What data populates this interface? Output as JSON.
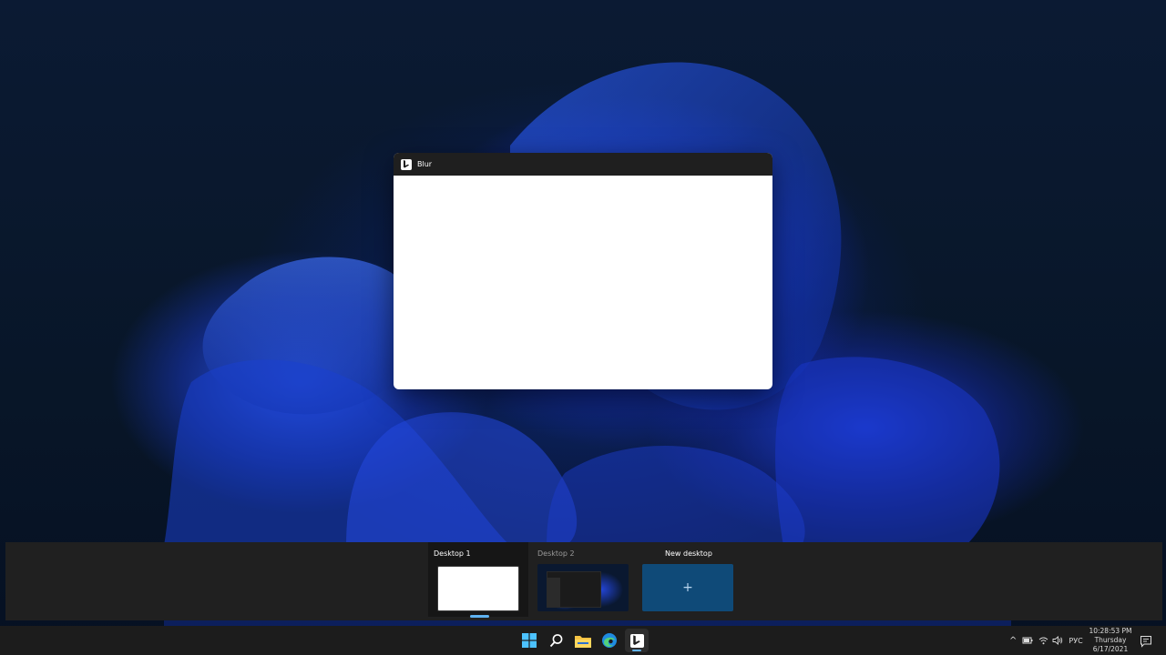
{
  "window": {
    "title": "Blur",
    "app_icon": "bing-b-icon"
  },
  "desktops": {
    "items": [
      {
        "label": "Desktop 1",
        "active": true
      },
      {
        "label": "Desktop 2",
        "active": false
      },
      {
        "label": "New desktop",
        "symbol": "+"
      }
    ]
  },
  "taskbar": {
    "apps": [
      {
        "name": "start",
        "icon": "windows-logo-icon"
      },
      {
        "name": "search",
        "icon": "search-icon"
      },
      {
        "name": "file-explorer",
        "icon": "folder-icon"
      },
      {
        "name": "edge",
        "icon": "edge-icon"
      },
      {
        "name": "blur",
        "icon": "bing-b-icon",
        "running": true
      }
    ],
    "tray": {
      "chevron": "^",
      "language": "РУС"
    },
    "clock": {
      "time": "10:28:53 PM",
      "day": "Thursday",
      "date": "6/17/2021"
    }
  },
  "colors": {
    "accent": "#5fb2f0",
    "new_desktop_bg": "#0f4a78",
    "taskbar_bg": "#1c1c1c"
  }
}
